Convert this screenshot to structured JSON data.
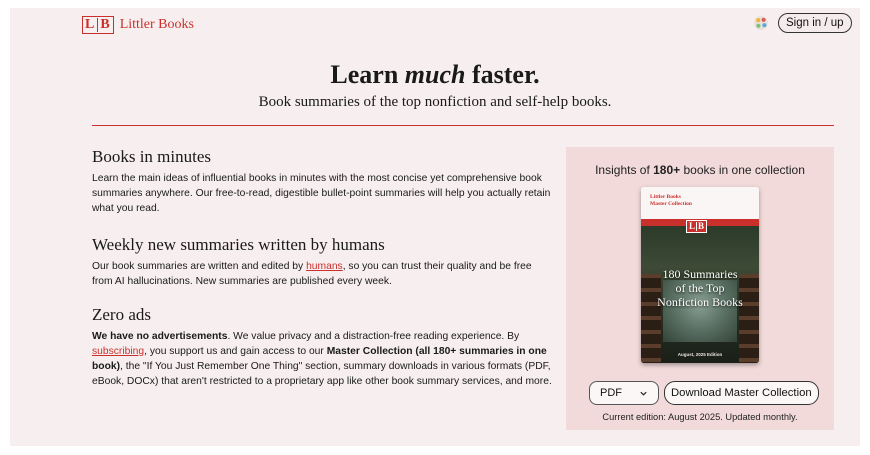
{
  "header": {
    "logo_letter_1": "L",
    "logo_letter_2": "B",
    "logo_text": "Littler Books",
    "signin_label": "Sign in / up",
    "theme_icon": "palette-icon"
  },
  "hero": {
    "title_pre": "Learn ",
    "title_em": "much",
    "title_post": " faster.",
    "subtitle": "Book summaries of the top nonfiction and self-help books."
  },
  "sections": {
    "s1": {
      "heading": "Books in minutes",
      "body": "Learn the main ideas of influential books in minutes with the most concise yet comprehensive book summaries anywhere. Our free-to-read, digestible bullet-point summaries will help you actually retain what you read."
    },
    "s2": {
      "heading": "Weekly new summaries written by humans",
      "body_pre": "Our book summaries are written and edited by ",
      "link": "humans",
      "body_post": ", so you can trust their quality and be free from AI hallucinations. New summaries are published every week."
    },
    "s3": {
      "heading": "Zero ads",
      "bold_1": "We have no advertisements",
      "text_1": ". We value privacy and a distraction-free reading experience. By ",
      "link": "subscribing",
      "text_2": ", you support us and gain access to our ",
      "bold_2": "Master Collection (all 180+ summaries in one book)",
      "text_3": ", the \"If You Just Remember One Thing\" section, summary downloads in various formats (PDF, eBook, DOCx) that aren't restricted to a proprietary app like other book summary services, and more."
    }
  },
  "panel": {
    "title_pre": "Insights of ",
    "title_bold": "180+",
    "title_post": " books in one collection",
    "book": {
      "top_line_1": "Littler Books",
      "top_line_2": "Master Collection",
      "logo_letter_1": "L",
      "logo_letter_2": "B",
      "title_line_1": "180 Summaries",
      "title_line_2": "of the Top",
      "title_line_3": "Nonfiction Books",
      "edition": "August, 2025 Edition"
    },
    "format_selected": "PDF",
    "download_label": "Download Master Collection",
    "edition_note": "Current edition: August 2025. Updated monthly."
  },
  "colors": {
    "accent": "#c9302c",
    "page_bg": "#f7efef",
    "panel_bg": "#f2dada"
  }
}
